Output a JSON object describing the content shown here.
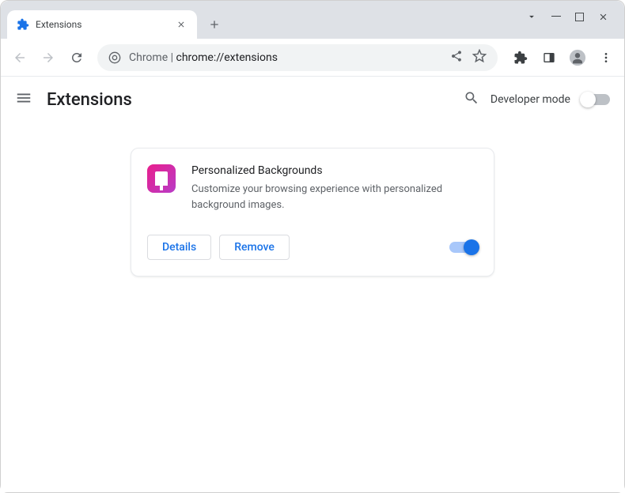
{
  "tab": {
    "title": "Extensions"
  },
  "omnibox": {
    "prefix": "Chrome",
    "url": "chrome://extensions"
  },
  "page": {
    "title": "Extensions",
    "developer_mode_label": "Developer mode"
  },
  "extension": {
    "name": "Personalized Backgrounds",
    "description": "Customize your browsing experience with personalized background images.",
    "details_label": "Details",
    "remove_label": "Remove"
  }
}
